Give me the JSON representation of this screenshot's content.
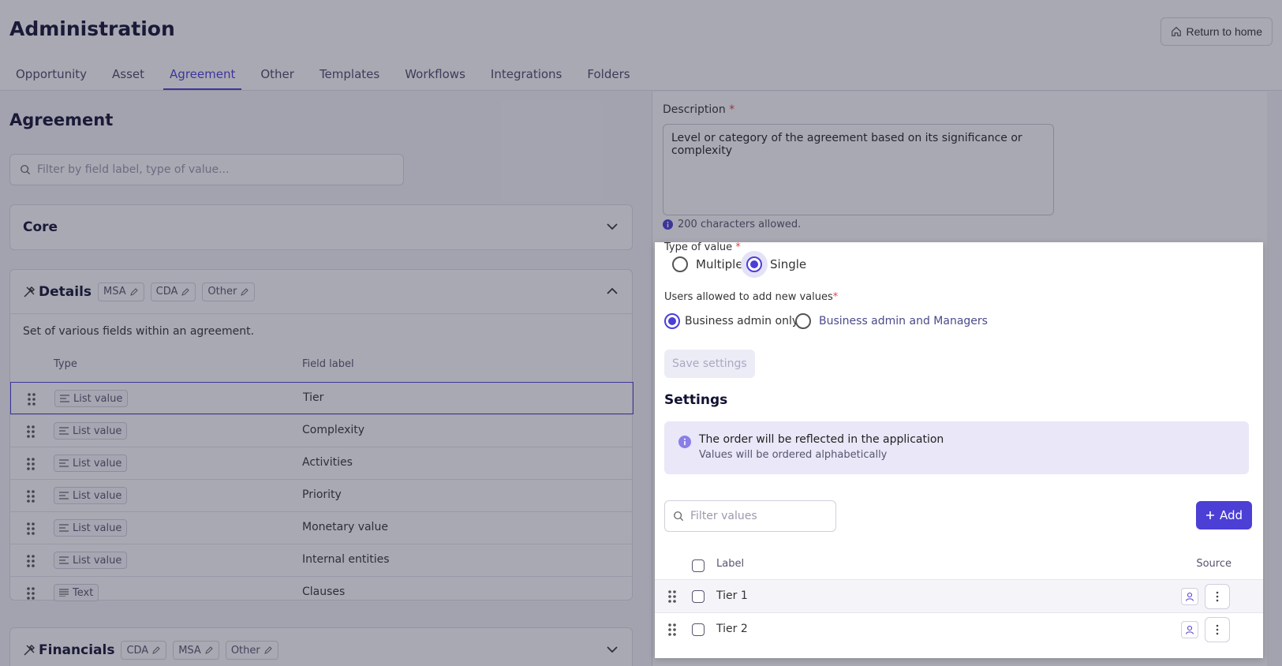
{
  "header": {
    "title": "Administration",
    "return_label": "Return to home",
    "tabs": [
      {
        "label": "Opportunity"
      },
      {
        "label": "Asset"
      },
      {
        "label": "Agreement"
      },
      {
        "label": "Other"
      },
      {
        "label": "Templates"
      },
      {
        "label": "Workflows"
      },
      {
        "label": "Integrations"
      },
      {
        "label": "Folders"
      }
    ],
    "active_tab": "Agreement"
  },
  "left": {
    "section_title": "Agreement",
    "filter_placeholder": "Filter by field label, type of value...",
    "core": {
      "title": "Core"
    },
    "details": {
      "title": "Details",
      "tags": [
        "MSA",
        "CDA",
        "Other"
      ],
      "description": "Set of various fields within an agreement.",
      "columns": {
        "type": "Type",
        "field_label": "Field label"
      },
      "rows": [
        {
          "type": "List value",
          "label": "Tier"
        },
        {
          "type": "List value",
          "label": "Complexity"
        },
        {
          "type": "List value",
          "label": "Activities"
        },
        {
          "type": "List value",
          "label": "Priority"
        },
        {
          "type": "List value",
          "label": "Monetary value"
        },
        {
          "type": "List value",
          "label": "Internal entities"
        },
        {
          "type": "Text",
          "label": "Clauses"
        }
      ]
    },
    "financials": {
      "title": "Financials",
      "tags": [
        "CDA",
        "MSA",
        "Other"
      ]
    }
  },
  "right": {
    "description_label": "Description",
    "description_value": "Level or category of the agreement based on its significance or complexity",
    "char_note": "200 characters allowed."
  },
  "popup": {
    "type_of_value_label": "Type of value",
    "type_options": [
      "Multiple",
      "Single"
    ],
    "type_selected": "Single",
    "users_allowed_label": "Users allowed to add new values",
    "users_options": [
      "Business admin only",
      "Business admin and Managers"
    ],
    "users_selected": "Business admin only",
    "save_label": "Save settings",
    "settings_title": "Settings",
    "info_title": "The order will be reflected in the application",
    "info_subtitle": "Values will be ordered alphabetically",
    "filter_placeholder": "Filter values",
    "add_label": "Add",
    "columns": {
      "label": "Label",
      "source": "Source"
    },
    "values": [
      {
        "label": "Tier 1"
      },
      {
        "label": "Tier 2"
      }
    ]
  },
  "colors": {
    "accent": "#4c3fd6",
    "required": "#e04545"
  }
}
